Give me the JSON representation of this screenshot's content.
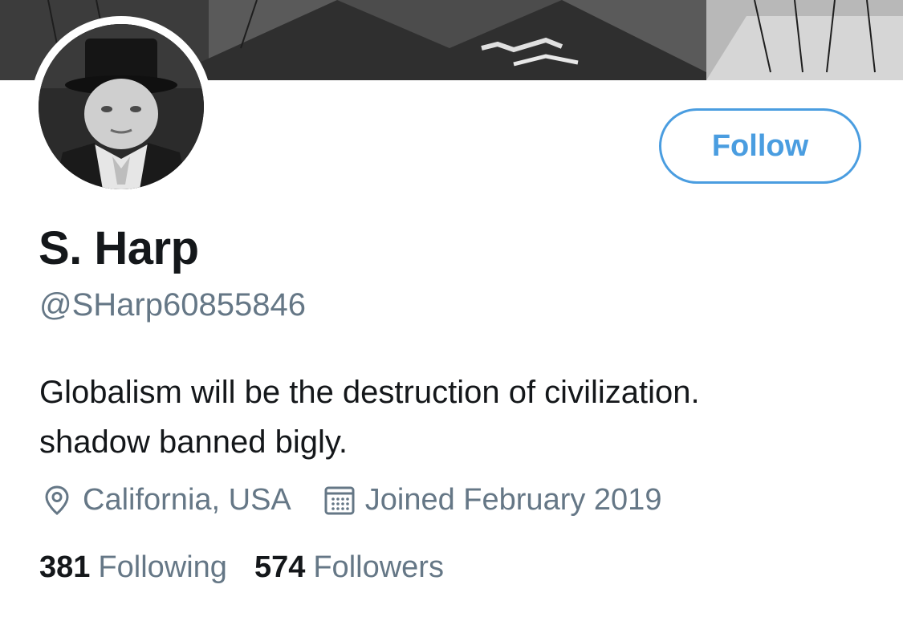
{
  "profile": {
    "display_name": "S. Harp",
    "handle": "@SHarp60855846",
    "bio_line1": "Globalism will be the destruction of civilization.",
    "bio_line2": "shadow banned bigly.",
    "location": "California, USA",
    "joined": "Joined February 2019",
    "following_count": "381",
    "following_label": "Following",
    "followers_count": "574",
    "followers_label": "Followers"
  },
  "actions": {
    "follow_label": "Follow"
  },
  "icons": {
    "location": "location-pin-icon",
    "joined": "calendar-icon"
  },
  "colors": {
    "accent": "#4a9de0",
    "text_primary": "#14171a",
    "text_secondary": "#657786",
    "background": "#ffffff"
  }
}
